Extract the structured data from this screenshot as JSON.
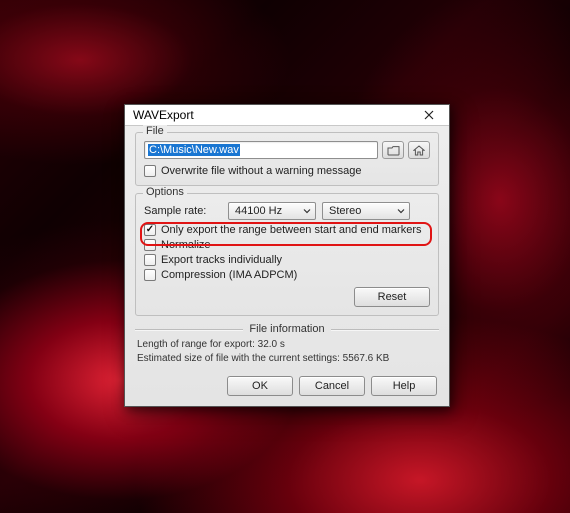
{
  "dialog": {
    "title": "WAVExport",
    "file_group": {
      "legend": "File",
      "path": "C:\\Music\\New.wav",
      "overwrite_checked": false,
      "overwrite_label": "Overwrite file without a warning message"
    },
    "options_group": {
      "legend": "Options",
      "sample_rate_label": "Sample rate:",
      "sample_rate_value": "44100 Hz",
      "channels_value": "Stereo",
      "checks": {
        "range": {
          "checked": true,
          "label": "Only export the range between start and end markers"
        },
        "normalize": {
          "checked": false,
          "label": "Normalize"
        },
        "tracks_individually": {
          "checked": false,
          "label": "Export tracks individually"
        },
        "compression": {
          "checked": false,
          "label": "Compression (IMA ADPCM)"
        }
      },
      "reset_label": "Reset"
    },
    "file_info": {
      "heading": "File information",
      "length_line": "Length of range for export: 32.0 s",
      "size_line": "Estimated size of file with the current settings: 5567.6 KB"
    },
    "buttons": {
      "ok": "OK",
      "cancel": "Cancel",
      "help": "Help"
    }
  }
}
